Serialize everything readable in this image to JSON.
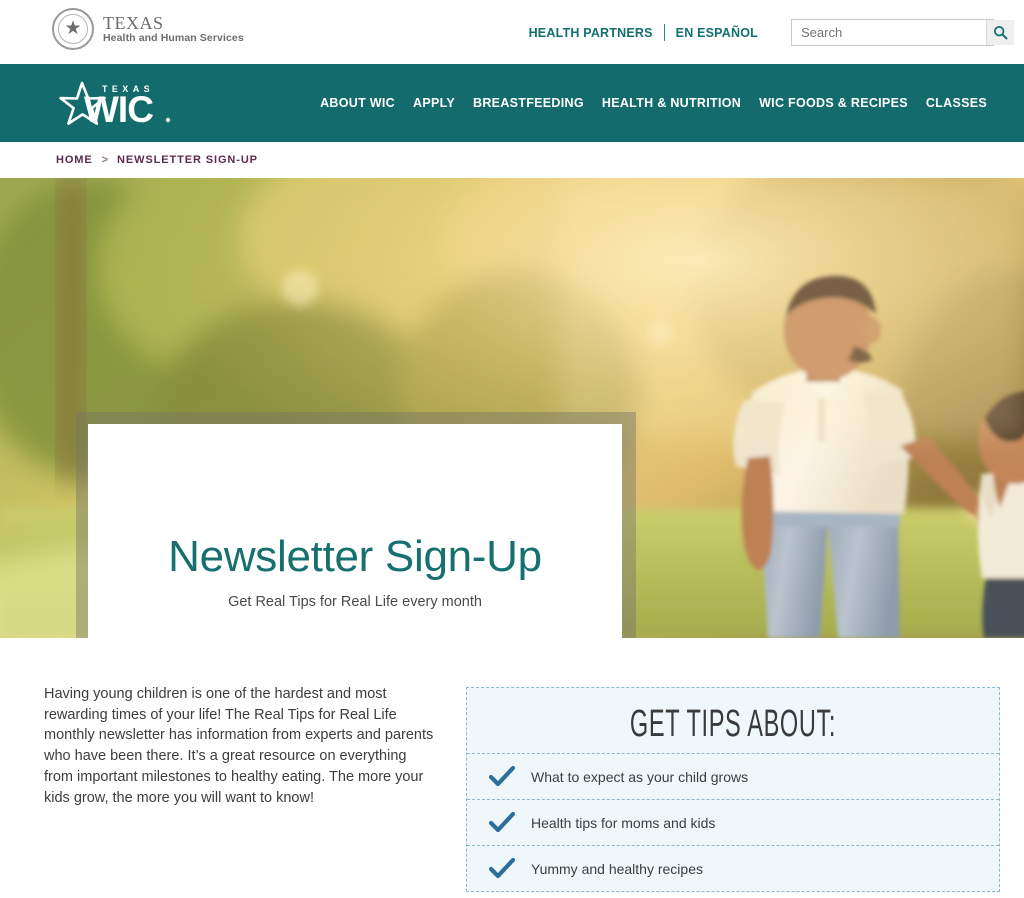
{
  "utility": {
    "logo": {
      "seal_icon": "texas-state-seal-icon",
      "line1": "TEXAS",
      "line2": "Health and Human Services"
    },
    "links": [
      {
        "label": "HEALTH PARTNERS"
      },
      {
        "label": "EN ESPAÑOL"
      }
    ],
    "search": {
      "placeholder": "Search",
      "value": "",
      "icon": "search-icon"
    }
  },
  "brand": {
    "logo_small_text": "TEXAS",
    "logo_main_text": "WIC",
    "logo_icon": "star-icon"
  },
  "nav": {
    "items": [
      {
        "label": "ABOUT WIC"
      },
      {
        "label": "APPLY"
      },
      {
        "label": "BREASTFEEDING"
      },
      {
        "label": "HEALTH & NUTRITION"
      },
      {
        "label": "WIC FOODS & RECIPES"
      },
      {
        "label": "CLASSES"
      }
    ]
  },
  "breadcrumb": {
    "items": [
      {
        "label": "HOME"
      },
      {
        "label": "NEWSLETTER SIGN-UP"
      }
    ],
    "separator": ">"
  },
  "hero": {
    "title": "Newsletter Sign-Up",
    "subtitle": "Get Real Tips for Real Life every month",
    "image_alt": "Father holding a child's hand walking in a sunlit park"
  },
  "main": {
    "intro": "Having young children is one of the hardest and most rewarding times of your life! The Real Tips for Real Life monthly newsletter has information from experts and parents who have been there. It’s a great resource on everything from important milestones to healthy eating. The more your kids grow, the more you will want to know!",
    "tips": {
      "heading": "GET TIPS ABOUT:",
      "items": [
        {
          "label": "What to expect as your child grows"
        },
        {
          "label": "Health tips for moms and kids"
        },
        {
          "label": "Yummy and healthy recipes"
        }
      ]
    }
  },
  "colors": {
    "teal": "#136b6b",
    "hero_title": "#15706f",
    "breadcrumb": "#5f2b50",
    "tips_background": "#eff7fb",
    "tips_border": "#8fb8cf",
    "check": "#2c6e9b"
  }
}
